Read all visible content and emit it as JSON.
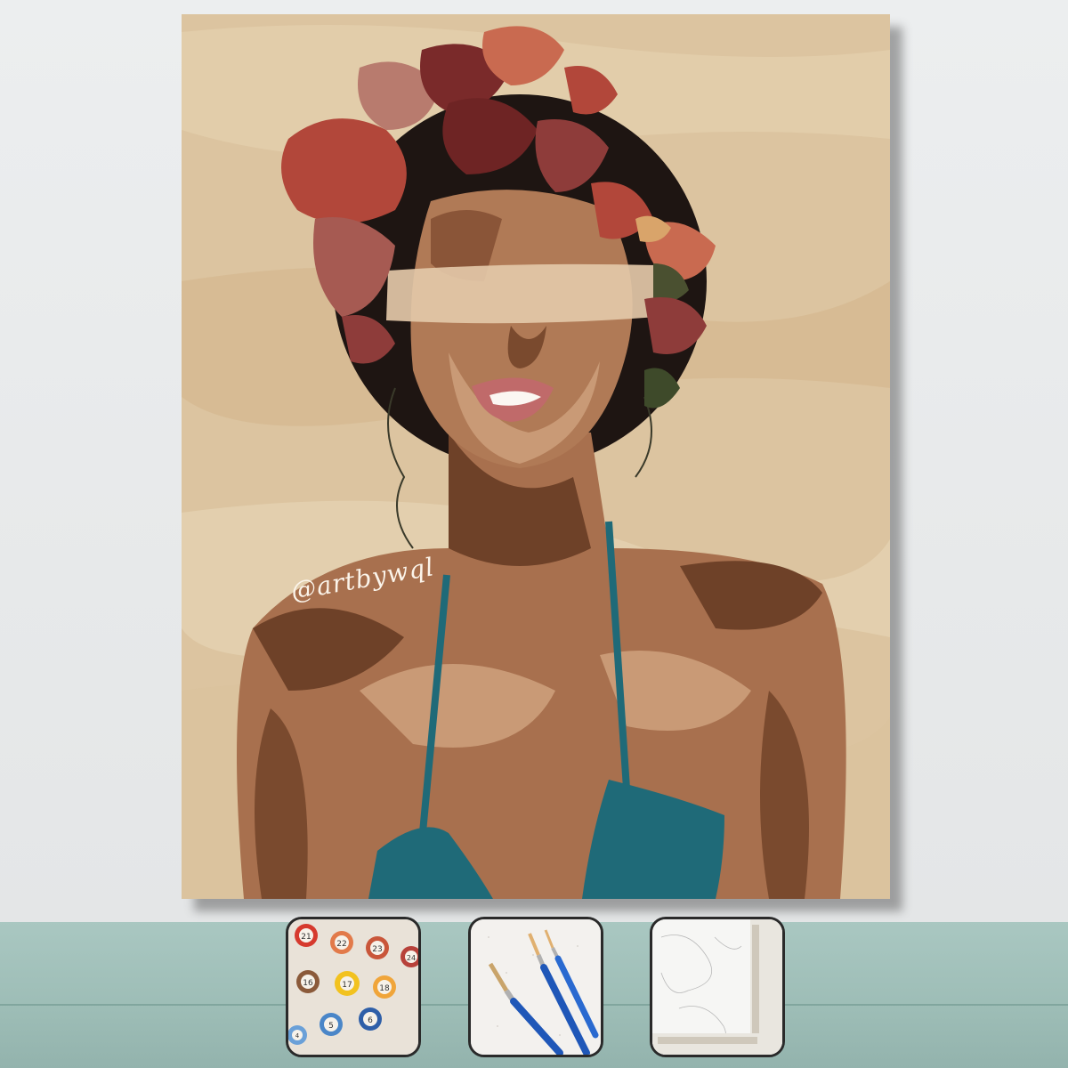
{
  "painting": {
    "signature": "@artbywql",
    "colors": {
      "background": "#dcc4a0",
      "skin_mid": "#a8704e",
      "skin_dark": "#6e4128",
      "skin_light": "#c99a76",
      "top": "#1f6a78",
      "hair": "#1e1512",
      "flowers": [
        "#b2473a",
        "#c96a50",
        "#8e3c3a",
        "#b87b6e",
        "#7a2a2a",
        "#d9a46a",
        "#4a5030"
      ]
    }
  },
  "kit_items": [
    {
      "name": "paint-pots",
      "numbers": [
        "21",
        "22",
        "23",
        "24",
        "16",
        "17",
        "18",
        "5",
        "6",
        "4"
      ]
    },
    {
      "name": "brushes"
    },
    {
      "name": "canvas-frame"
    }
  ]
}
